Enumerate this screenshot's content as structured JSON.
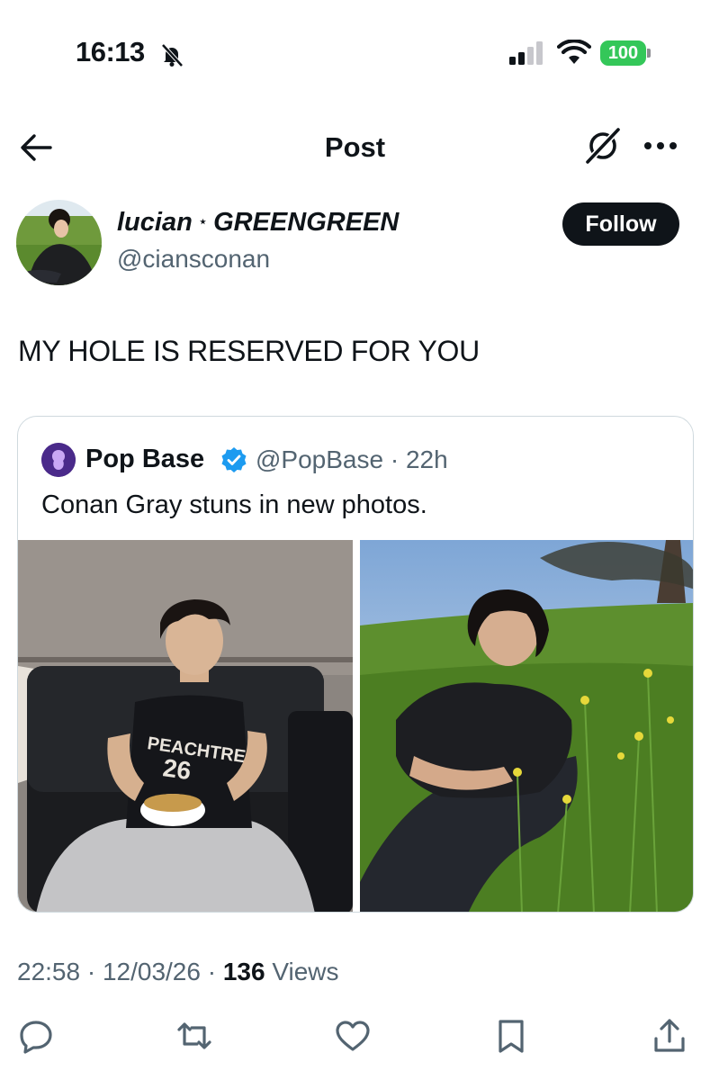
{
  "status_bar": {
    "time": "16:13",
    "battery": "100",
    "icons": [
      "bell-slash-icon",
      "cellular-signal-icon",
      "wifi-icon",
      "battery-icon"
    ]
  },
  "header": {
    "title": "Post",
    "icons": [
      "back-arrow-icon",
      "grok-icon",
      "more-dots-icon"
    ]
  },
  "author": {
    "name_part1": "lucian",
    "separator": "⋆",
    "name_part2": "GREENGREEN",
    "handle": "@ciansconan",
    "follow_label": "Follow"
  },
  "tweet": {
    "text": "MY HOLE IS RESERVED FOR YOU"
  },
  "quote": {
    "name": "Pop Base",
    "handle_time": "@PopBase · 22h",
    "text": "Conan Gray stuns in new photos."
  },
  "meta": {
    "time_date": "22:58 · 12/03/26 · ",
    "views_count": "136",
    "views_label": " Views"
  },
  "actions": [
    "reply-icon",
    "retweet-icon",
    "like-icon",
    "bookmark-icon",
    "share-icon"
  ],
  "colors": {
    "text": "#0f1419",
    "secondary": "#536471",
    "border": "#cfd9de",
    "verified": "#1d9bf0",
    "battery": "#34c759"
  }
}
